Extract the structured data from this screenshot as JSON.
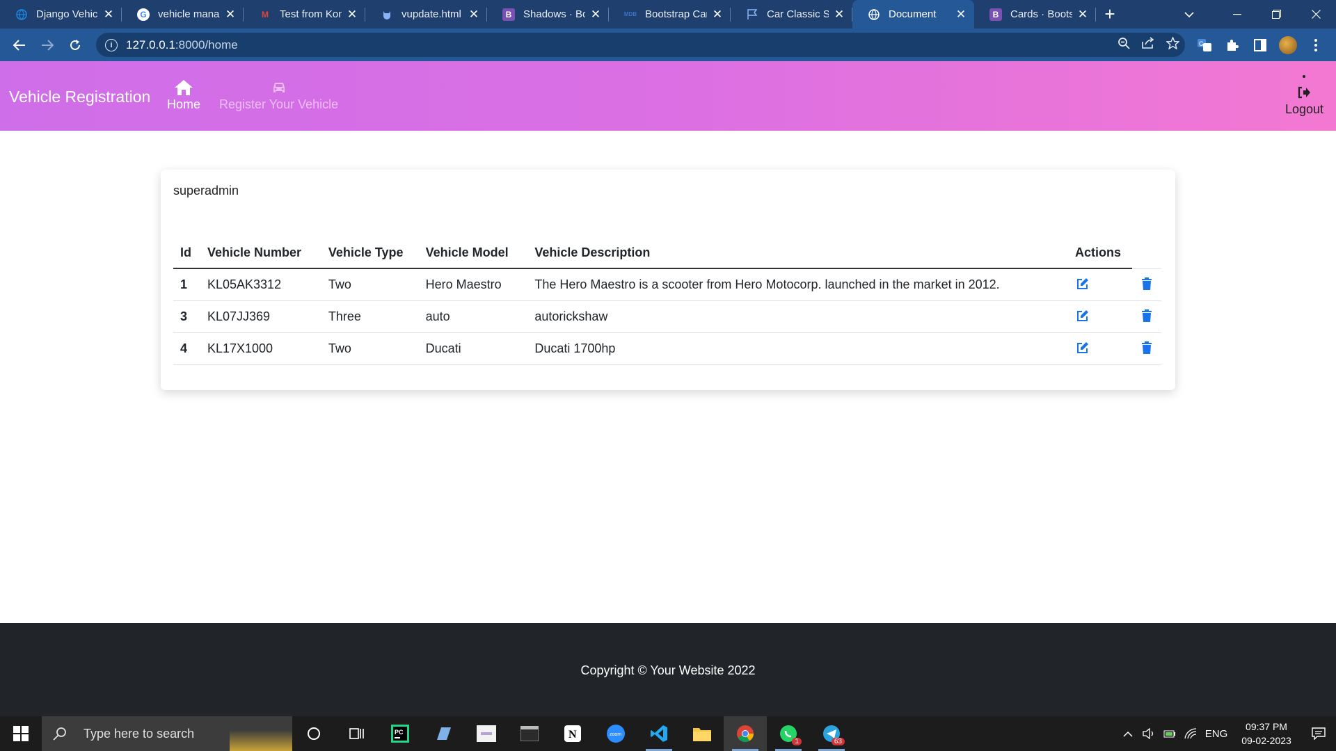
{
  "browser": {
    "tabs": [
      {
        "title": "Django Vehicle",
        "favicon": "django-favicon",
        "color": "#1e88e5"
      },
      {
        "title": "vehicle manag",
        "favicon": "google-favicon",
        "color": "#ffffff"
      },
      {
        "title": "Test from Kon",
        "favicon": "gmail-favicon",
        "color": "#ea4335"
      },
      {
        "title": "vupdate.html",
        "favicon": "github-favicon",
        "color": "#8ab4f8"
      },
      {
        "title": "Shadows · Boo",
        "favicon": "bootstrap-favicon",
        "color": "#7952b3"
      },
      {
        "title": "Bootstrap Car",
        "favicon": "mdb-favicon",
        "color": "#3b71ca"
      },
      {
        "title": "Car Classic Sol",
        "favicon": "flag-favicon",
        "color": "#8ab4f8"
      },
      {
        "title": "Document",
        "favicon": "globe-favicon",
        "color": "#ffffff",
        "active": true
      },
      {
        "title": "Cards · Bootstr",
        "favicon": "bootstrap-favicon",
        "color": "#7952b3"
      }
    ],
    "favicon_letters": {
      "B": "B",
      "M": "M",
      "MDB": "MDB",
      "PC": "PC",
      "N": "N",
      "zoom": "zoom"
    },
    "url": "127.0.0.1:8000/home",
    "url_host": "127.0.0.1",
    "url_path": ":8000/home"
  },
  "app": {
    "brand": "Vehicle Registration",
    "nav": {
      "home": "Home",
      "register": "Register Your Vehicle",
      "logout": "Logout"
    },
    "accent_color": "#1a73e8",
    "username": "superadmin",
    "table": {
      "headers": {
        "id": "Id",
        "number": "Vehicle Number",
        "type": "Vehicle Type",
        "model": "Vehicle Model",
        "description": "Vehicle Description",
        "actions": "Actions"
      },
      "rows": [
        {
          "id": "1",
          "number": "KL05AK3312",
          "type": "Two",
          "model": "Hero Maestro",
          "description": "The Hero Maestro is a scooter from Hero Motocorp. launched in the market in 2012."
        },
        {
          "id": "3",
          "number": "KL07JJ369",
          "type": "Three",
          "model": "auto",
          "description": "autorickshaw"
        },
        {
          "id": "4",
          "number": "KL17X1000",
          "type": "Two",
          "model": "Ducati",
          "description": "Ducati 1700hp"
        }
      ]
    },
    "footer": "Copyright © Your Website 2022"
  },
  "taskbar": {
    "search_placeholder": "Type here to search",
    "whatsapp_badge": "1",
    "telegram_badge": "63",
    "language": "ENG",
    "time": "09:37 PM",
    "date": "09-02-2023"
  }
}
